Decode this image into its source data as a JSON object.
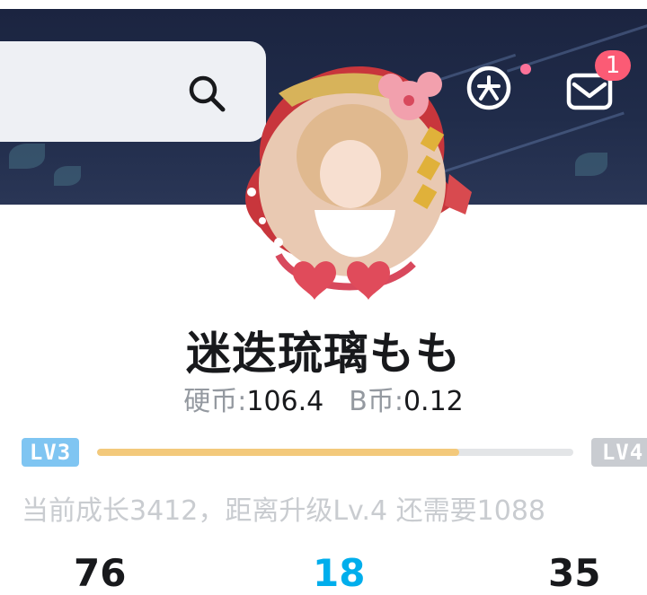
{
  "header": {
    "search_placeholder": "",
    "mail_unread": "1",
    "icons": [
      "search-icon",
      "da-member-icon",
      "mail-icon"
    ]
  },
  "profile": {
    "username": "迷迭琉璃もも",
    "coins_label": "硬币:",
    "coins_value": "106.4",
    "bcoins_label": "B币:",
    "bcoins_value": "0.12",
    "level_current": "LV3",
    "level_next": "LV4",
    "progress_fraction": 0.76,
    "growth_text": "当前成长3412，距离升级Lv.4 还需要1088"
  },
  "stats": {
    "values": [
      "76",
      "18",
      "35"
    ]
  },
  "colors": {
    "accent_pink": "#fb7299",
    "accent_blue": "#00aeec",
    "progress_fill": "#f3c97b",
    "level_current_badge": "#7fc5f2",
    "level_next_badge": "#c9ccd1"
  }
}
